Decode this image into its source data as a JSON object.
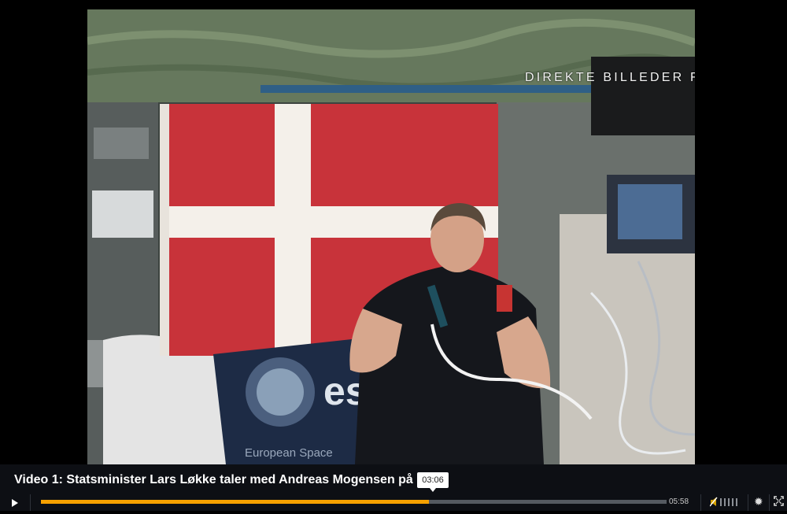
{
  "overlay": {
    "live_label": "DIREKTE BILLEDER FRA ISS"
  },
  "player": {
    "title": "Video 1: Statsminister Lars Løkke taler med Andreas Mogensen på",
    "hover_time": "03:06",
    "duration": "05:58",
    "progress_fraction": 0.62,
    "accent_color": "#f6a100",
    "controls": {
      "play_icon": "play-icon",
      "mute_icon": "speaker-muted-icon",
      "volume_icon": "volume-bars-icon",
      "settings_icon": "gear-icon",
      "fullscreen_icon": "fullscreen-icon"
    }
  },
  "scene": {
    "flag_colors": {
      "red": "#c8333a",
      "white": "#f4f0ea"
    },
    "banner_text": "esa",
    "banner_subtext": "European Space"
  }
}
